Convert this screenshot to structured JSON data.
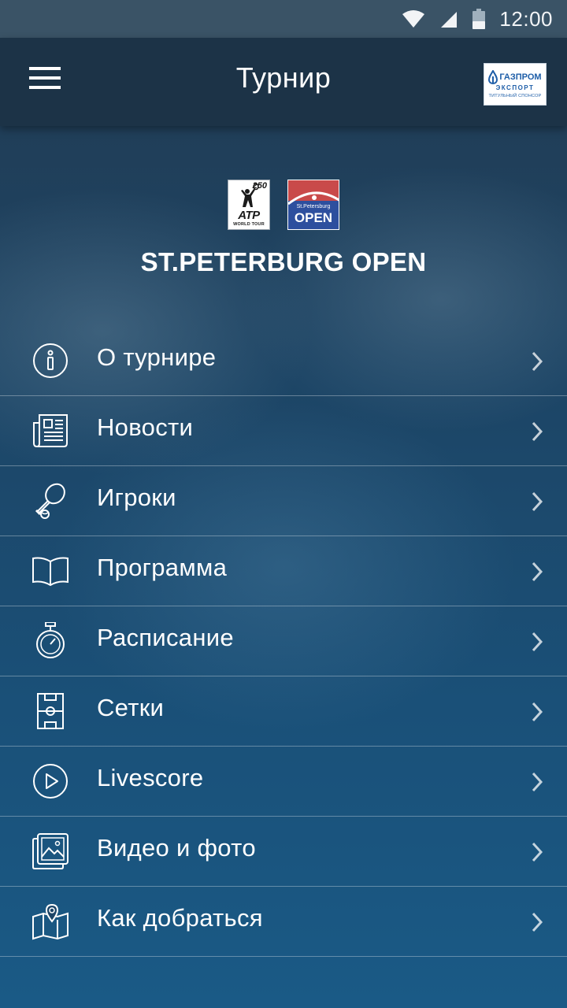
{
  "status_bar": {
    "time": "12:00",
    "icons": [
      "wifi-icon",
      "signal-icon",
      "battery-icon"
    ]
  },
  "app_bar": {
    "title": "Турнир",
    "menu_icon": "hamburger-menu-icon",
    "sponsor": {
      "name": "ГАЗПРОМ",
      "sub": "ЭКСПОРТ",
      "caption": "ТИТУЛЬНЫЙ СПОНСОР"
    }
  },
  "logos": {
    "atp": {
      "number": "250",
      "text": "ATP",
      "sub": "WORLD TOUR"
    },
    "spb": {
      "city": "St.Petersburg",
      "text": "OPEN"
    }
  },
  "tournament_name": "ST.PETERBURG OPEN",
  "menu": {
    "items": [
      {
        "label": "О турнире",
        "icon": "info-icon"
      },
      {
        "label": "Новости",
        "icon": "newspaper-icon"
      },
      {
        "label": "Игроки",
        "icon": "tennis-racket-icon"
      },
      {
        "label": "Программа",
        "icon": "open-book-icon"
      },
      {
        "label": "Расписание",
        "icon": "stopwatch-icon"
      },
      {
        "label": "Сетки",
        "icon": "court-icon"
      },
      {
        "label": "Livescore",
        "icon": "play-circle-icon"
      },
      {
        "label": "Видео и фото",
        "icon": "photo-gallery-icon"
      },
      {
        "label": "Как добраться",
        "icon": "map-pin-icon"
      }
    ]
  },
  "colors": {
    "status_bar": "#3a5366",
    "app_bar": "#1c3347",
    "background_top": "#223b52",
    "background_bottom": "#1a5a86",
    "sponsor_blue": "#1e5ea8",
    "spb_red": "#c94a4a",
    "spb_blue": "#2d4f9e"
  }
}
